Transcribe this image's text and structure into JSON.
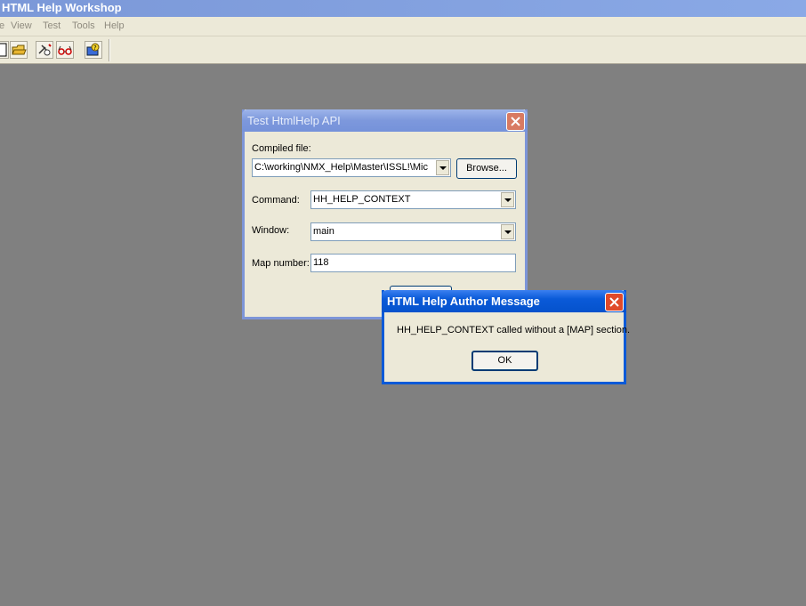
{
  "app": {
    "title": "HTML Help Workshop"
  },
  "menu": {
    "items": [
      "e",
      "View",
      "Test",
      "Tools",
      "Help"
    ]
  },
  "toolbar": {
    "icons": [
      "new-file-icon",
      "open-folder-icon",
      "compile-icon",
      "view-compiled-icon",
      "help-icon"
    ]
  },
  "test_dialog": {
    "title": "Test HtmlHelp API",
    "compiled_file_label": "Compiled file:",
    "compiled_file_value": "C:\\working\\NMX_Help\\Master\\ISSL!\\Mic",
    "browse_label": "Browse...",
    "command_label": "Command:",
    "command_value": "HH_HELP_CONTEXT",
    "window_label": "Window:",
    "window_value": "main",
    "map_number_label": "Map number:",
    "map_number_value": "118"
  },
  "message_box": {
    "title": "HTML Help Author Message",
    "message": "HH_HELP_CONTEXT called without a [MAP] section.",
    "ok_label": "OK"
  },
  "colors": {
    "workspace": "#808080",
    "dialog_face": "#ece9d8",
    "active_title": "#0a5ad8",
    "close_red": "#e04a2a"
  }
}
